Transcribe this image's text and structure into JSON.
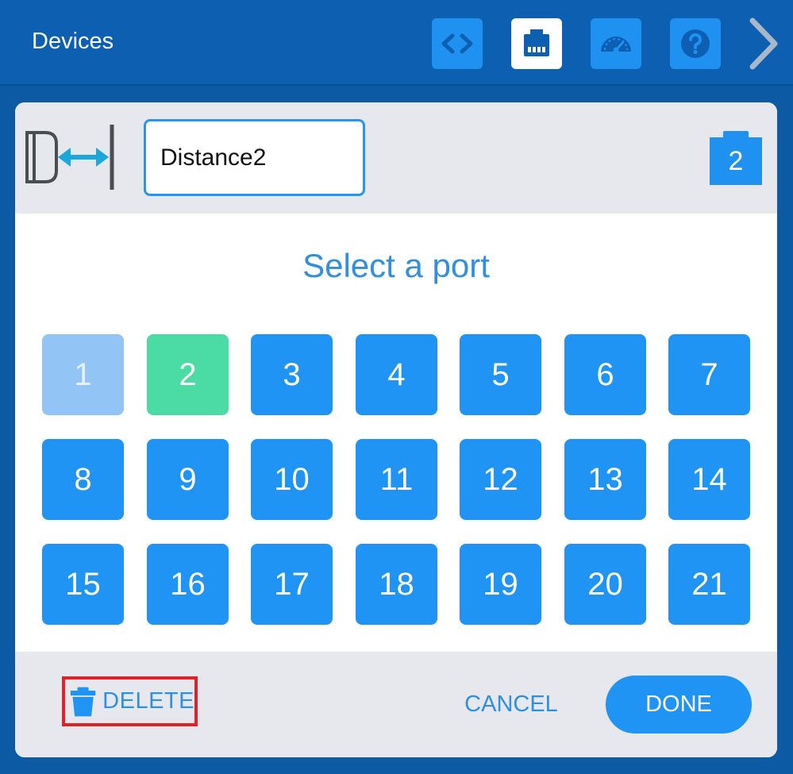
{
  "header": {
    "title": "Devices",
    "tools": [
      {
        "name": "code-icon",
        "active": false
      },
      {
        "name": "devices-port-icon",
        "active": true
      },
      {
        "name": "dashboard-gauge-icon",
        "active": false
      },
      {
        "name": "help-icon",
        "active": false
      }
    ],
    "next_icon": "chevron-right-icon"
  },
  "device": {
    "icon": "distance-sensor-icon",
    "name_value": "Distance2",
    "port_badge": "2"
  },
  "port_select": {
    "title": "Select a port",
    "disabled_ports": [
      "1"
    ],
    "selected_port": "2",
    "ports": [
      "1",
      "2",
      "3",
      "4",
      "5",
      "6",
      "7",
      "8",
      "9",
      "10",
      "11",
      "12",
      "13",
      "14",
      "15",
      "16",
      "17",
      "18",
      "19",
      "20",
      "21"
    ]
  },
  "footer": {
    "delete_label": "DELETE",
    "delete_icon": "trash-icon",
    "cancel_label": "CANCEL",
    "done_label": "DONE"
  },
  "colors": {
    "accent": "#1f94f5",
    "selected": "#4bdca6",
    "disabled": "#92c4f6",
    "highlight_outline": "#e2202a"
  }
}
